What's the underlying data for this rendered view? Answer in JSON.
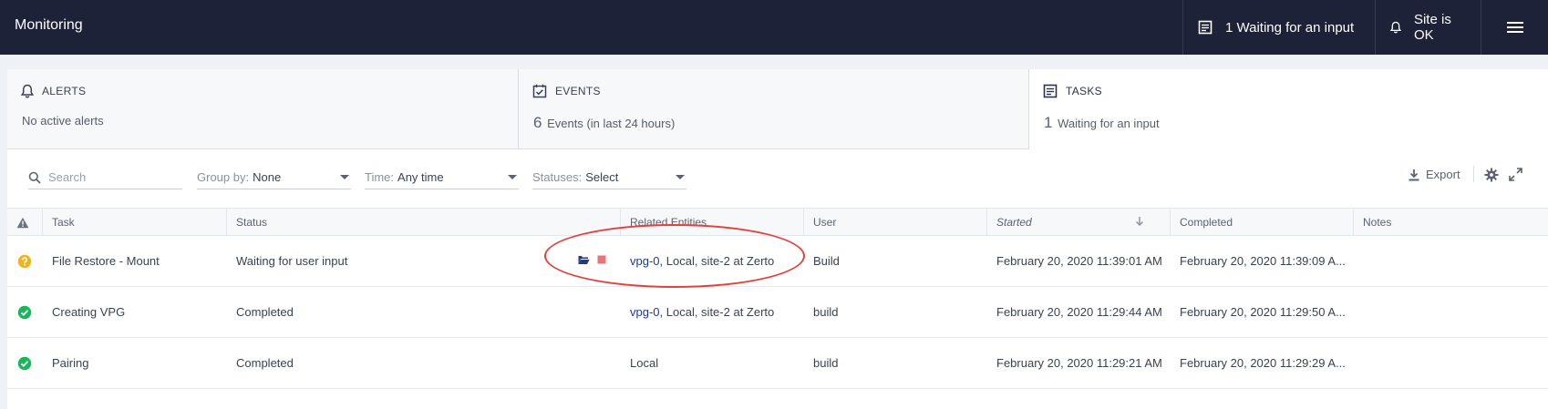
{
  "topbar": {
    "title": "Monitoring",
    "tasks_status": "1 Waiting for an input",
    "site_status": "Site is OK"
  },
  "summary": {
    "alerts": {
      "label": "ALERTS",
      "text": "No active alerts"
    },
    "events": {
      "label": "EVENTS",
      "count": "6",
      "text": "Events (in last 24 hours)"
    },
    "tasks": {
      "label": "TASKS",
      "count": "1",
      "text": "Waiting for an input"
    }
  },
  "toolbar": {
    "search_placeholder": "Search",
    "group_label": "Group by:",
    "group_value": "None",
    "time_label": "Time:",
    "time_value": "Any time",
    "status_label": "Statuses:",
    "status_value": "Select",
    "export_label": "Export"
  },
  "table": {
    "headers": {
      "task": "Task",
      "status": "Status",
      "related": "Related Entities",
      "user": "User",
      "started": "Started",
      "completed": "Completed",
      "notes": "Notes"
    },
    "rows": [
      {
        "state": "waiting",
        "task": "File Restore - Mount",
        "status": "Waiting for user input",
        "entity_link": "vpg-0",
        "entity_rest": ", Local, site-2 at Zerto",
        "user": "Build",
        "started": "February 20, 2020 11:39:01 AM",
        "completed": "February 20, 2020 11:39:09 A..."
      },
      {
        "state": "completed",
        "task": "Creating VPG",
        "status": "Completed",
        "entity_link": "vpg-0",
        "entity_rest": ", Local, site-2 at Zerto",
        "user": "build",
        "started": "February 20, 2020 11:29:44 AM",
        "completed": "February 20, 2020 11:29:50 A..."
      },
      {
        "state": "completed",
        "task": "Pairing",
        "status": "Completed",
        "entity_link": "",
        "entity_rest": "Local",
        "user": "build",
        "started": "February 20, 2020 11:29:21 AM",
        "completed": "February 20, 2020 11:29:29 A..."
      }
    ]
  },
  "colors": {
    "topbar_bg": "#1d2239",
    "waiting": "#f2b41c",
    "completed": "#1bb55a",
    "link": "#1e3a8a",
    "highlight": "#e0413d",
    "stop": "#e8737a"
  }
}
